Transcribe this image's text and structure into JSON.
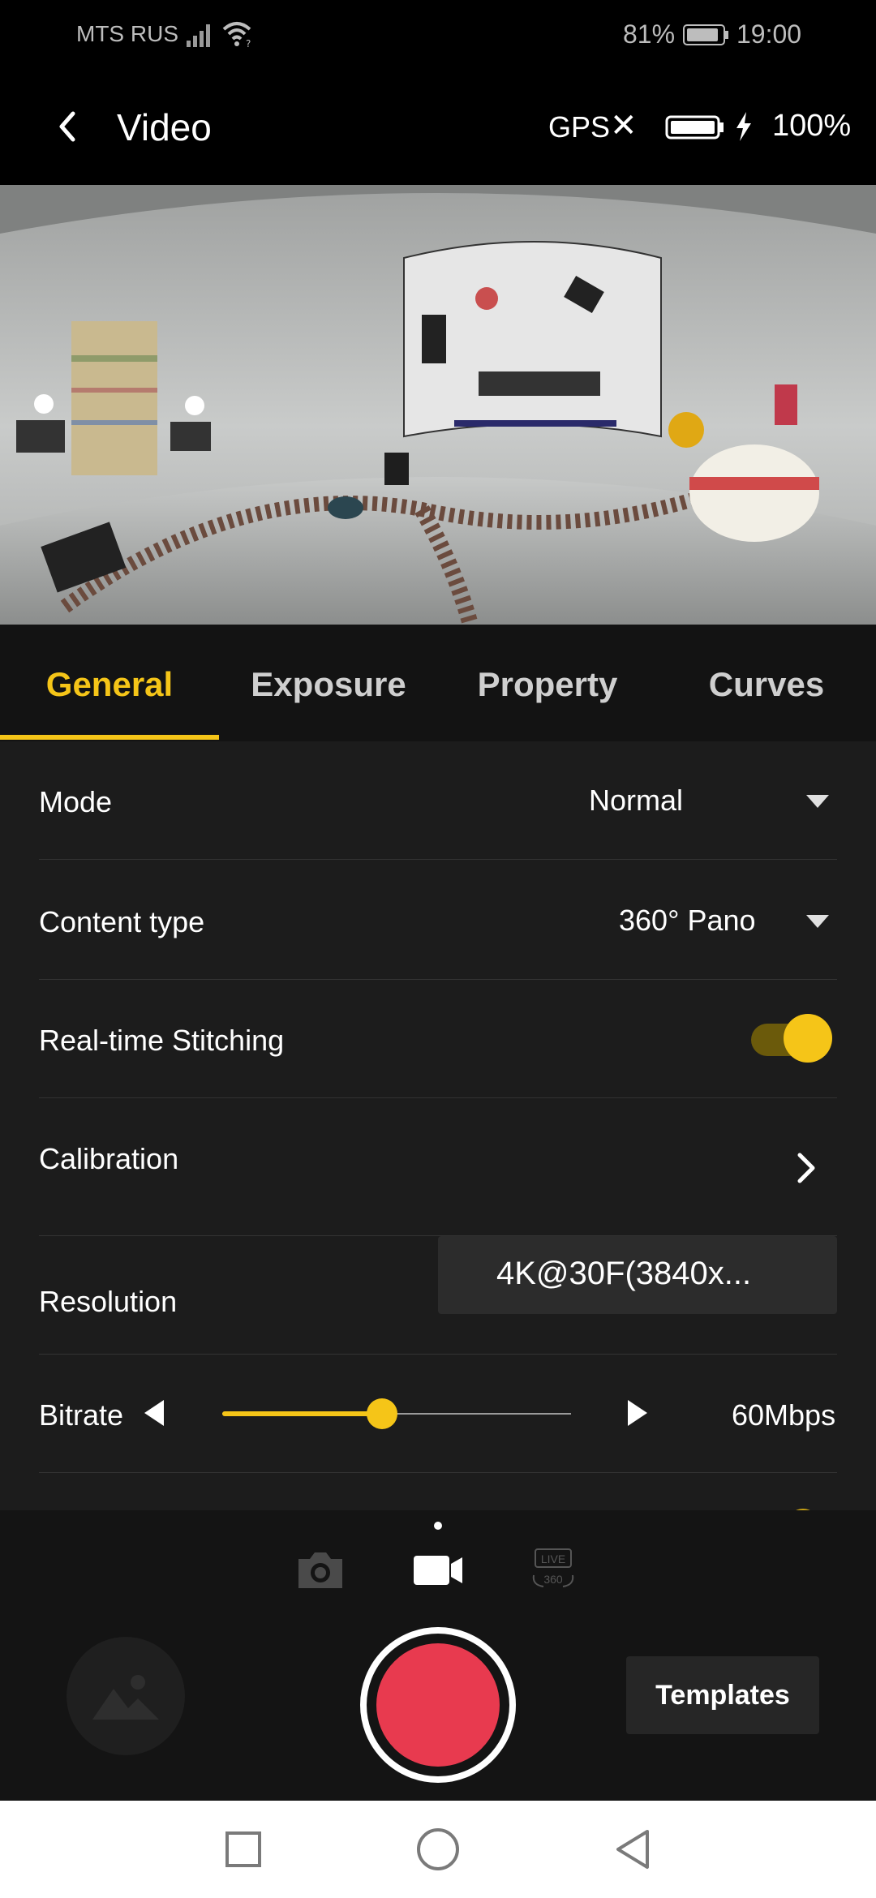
{
  "status_bar": {
    "carrier": "MTS RUS",
    "battery_percent": "81%",
    "time": "19:00"
  },
  "header": {
    "title": "Video",
    "gps_label": "GPS",
    "gps_status_icon": "x-icon",
    "camera_battery": "100%"
  },
  "tabs": [
    {
      "label": "General",
      "active": true
    },
    {
      "label": "Exposure",
      "active": false
    },
    {
      "label": "Property",
      "active": false
    },
    {
      "label": "Curves",
      "active": false
    }
  ],
  "settings": {
    "mode": {
      "label": "Mode",
      "value": "Normal"
    },
    "content_type": {
      "label": "Content type",
      "value": "360° Pano"
    },
    "realtime_stitching": {
      "label": "Real-time Stitching",
      "enabled": true
    },
    "calibration": {
      "label": "Calibration"
    },
    "resolution": {
      "label": "Resolution",
      "value": "4K@30F(3840x..."
    },
    "bitrate": {
      "label": "Bitrate",
      "value": "60Mbps",
      "slider_fraction": 0.46
    }
  },
  "capture_modes": [
    {
      "name": "camera-icon",
      "active": false
    },
    {
      "name": "video-icon",
      "active": true
    },
    {
      "name": "live-360-icon",
      "active": false,
      "text": "LIVE",
      "subtext": "360"
    }
  ],
  "bottom": {
    "templates_label": "Templates"
  },
  "colors": {
    "accent": "#f5c518",
    "record": "#e83a4f",
    "background": "#1c1c1c"
  }
}
